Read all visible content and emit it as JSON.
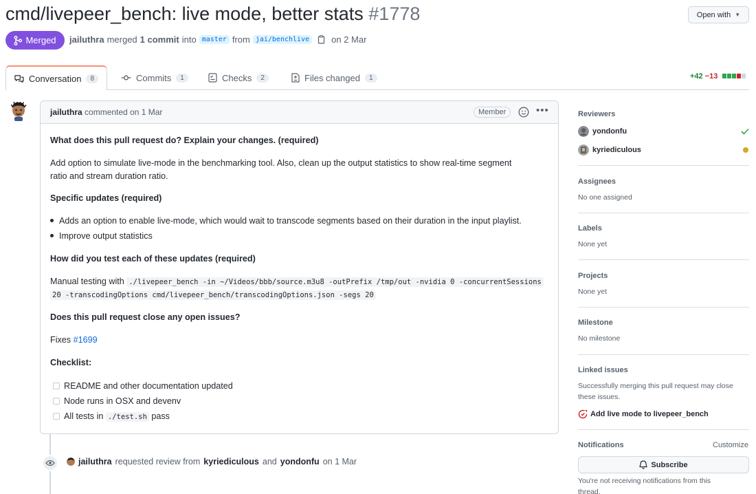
{
  "pr": {
    "title": "cmd/livepeer_bench: live mode, better stats",
    "number": "#1778",
    "open_with": "Open with",
    "status": "Merged",
    "author": "jailuthra",
    "merged_text": "merged",
    "commit_count_text": "1 commit",
    "into_text": "into",
    "base_branch": "master",
    "from_text": "from",
    "head_branch": "jai/benchlive",
    "date": "on 2 Mar"
  },
  "tabs": [
    {
      "label": "Conversation",
      "count": "8"
    },
    {
      "label": "Commits",
      "count": "1"
    },
    {
      "label": "Checks",
      "count": "2"
    },
    {
      "label": "Files changed",
      "count": "1"
    }
  ],
  "diffstat": {
    "additions": "+42",
    "deletions": "−13",
    "colors": {
      "add": "#2da44e",
      "del": "#cf222e",
      "neutral": "#d0d7de"
    }
  },
  "comment": {
    "author": "jailuthra",
    "action": "commented on 1 Mar",
    "badge": "Member",
    "q1": "What does this pull request do? Explain your changes. (required)",
    "a1_line1": "Add option to simulate live-mode in the benchmarking tool. Also, clean up the output statistics to show real-time segment",
    "a1_line2": "ratio and stream duration ratio.",
    "q2": "Specific updates (required)",
    "bullets": [
      "Adds an option to enable live-mode, which would wait to transcode segments based on their duration in the input playlist.",
      "Improve output statistics"
    ],
    "q3": "How did you test each of these updates (required)",
    "test_prefix": "Manual testing with",
    "test_code_line1": "./livepeer_bench -in ~/Videos/bbb/source.m3u8 -outPrefix /tmp/out -nvidia 0 -concurrentSessions",
    "test_code_line2": "20 -transcodingOptions cmd/livepeer_bench/transcodingOptions.json -segs 20",
    "q4": "Does this pull request close any open issues?",
    "fixes_label": "Fixes",
    "fixes_issue": "#1699",
    "checklist_title": "Checklist:",
    "checklist": [
      {
        "text": "README and other documentation updated"
      },
      {
        "text": "Node runs in OSX and devenv"
      },
      {
        "text_before": "All tests in",
        "code": "./test.sh",
        "text_after": "pass"
      }
    ]
  },
  "review_event": {
    "actor": "jailuthra",
    "text1": "requested review from",
    "reviewer1": "kyriediculous",
    "and_text": "and",
    "reviewer2": "yondonfu",
    "date": "on 1 Mar"
  },
  "sidebar": {
    "reviewers_title": "Reviewers",
    "reviewers": [
      {
        "name": "yondonfu",
        "status": "approved",
        "status_color": "#2da44e"
      },
      {
        "name": "kyriediculous",
        "status": "pending",
        "status_color": "#d4a72c"
      }
    ],
    "assignees_title": "Assignees",
    "assignees_value": "No one assigned",
    "labels_title": "Labels",
    "labels_value": "None yet",
    "projects_title": "Projects",
    "projects_value": "None yet",
    "milestone_title": "Milestone",
    "milestone_value": "No milestone",
    "linked_title": "Linked issues",
    "linked_desc_line1": "Successfully merging this pull request may close",
    "linked_desc_line2": "these issues.",
    "linked_issue": "Add live mode to livepeer_bench",
    "notifications_title": "Notifications",
    "customize": "Customize",
    "subscribe": "Subscribe",
    "notif_line1": "You're not receiving notifications from this",
    "notif_line2": "thread."
  },
  "colors": {
    "accent_merged": "#8250df",
    "link": "#0969da",
    "tab_underline": "#fd8c73"
  }
}
